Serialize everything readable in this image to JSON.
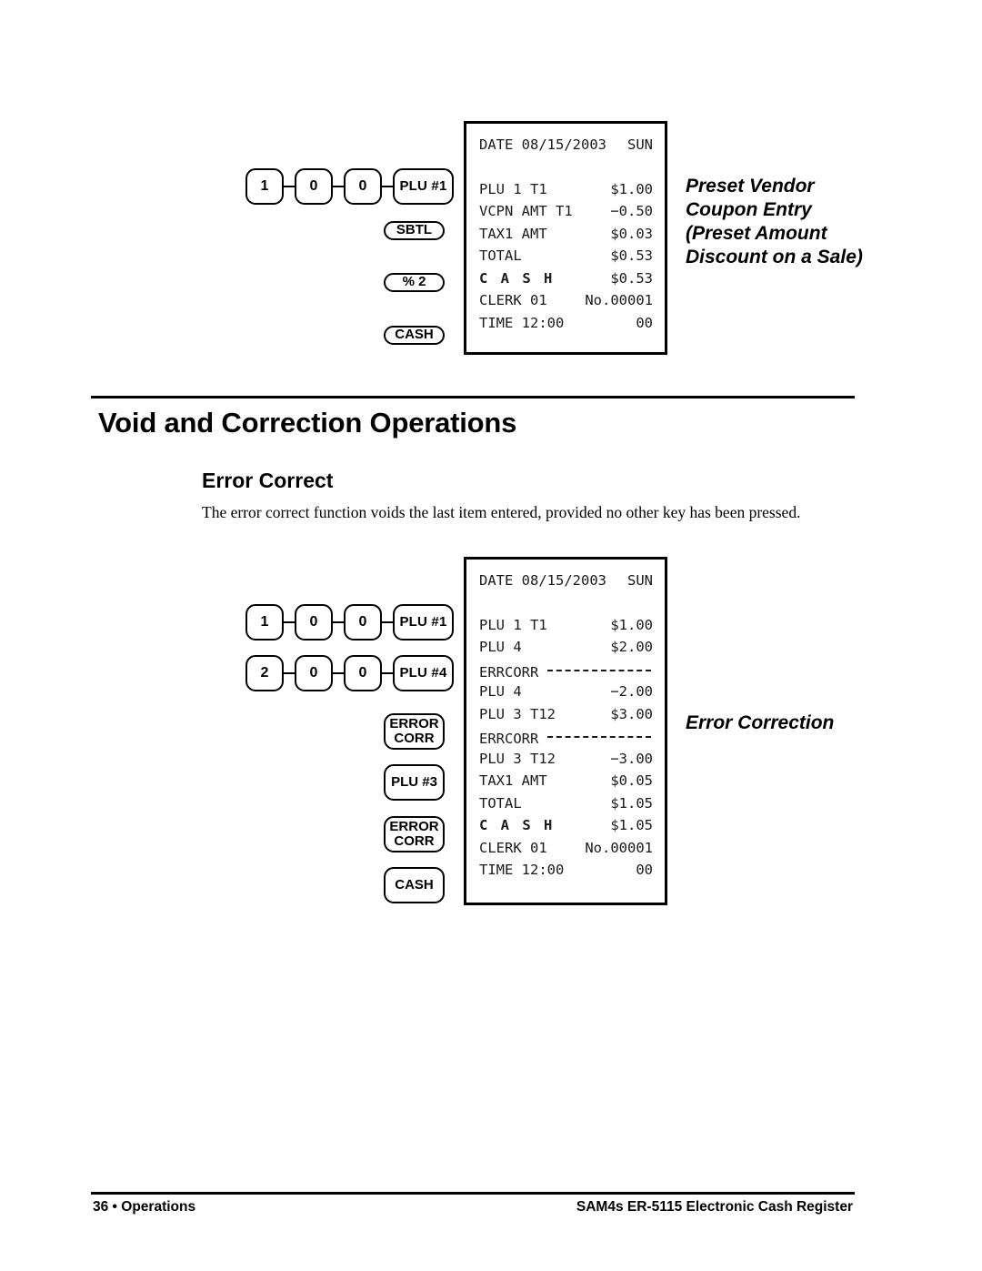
{
  "page": {
    "heading": "Void and Correction Operations",
    "subheading": "Error Correct",
    "body": "The error correct function voids the last item entered, provided no other key has been pressed."
  },
  "section_coupon": {
    "caption_line1": "Preset Vendor",
    "caption_line2": "Coupon Entry",
    "caption_line3": "(Preset Amount",
    "caption_line4": "Discount on a Sale)",
    "keys": {
      "row1": [
        "1",
        "0",
        "0",
        "PLU #1"
      ],
      "standalone": [
        {
          "label": "SBTL"
        },
        {
          "label": "% 2"
        },
        {
          "label": "CASH"
        }
      ]
    },
    "receipt": {
      "header": {
        "label": "DATE 08/15/2003",
        "amount": "SUN"
      },
      "lines": [
        {
          "label": "PLU 1 T1",
          "amount": "$1.00",
          "style": "normal"
        },
        {
          "label": "VCPN AMT T1",
          "amount": "−0.50",
          "style": "normal"
        },
        {
          "label": "TAX1 AMT",
          "amount": "$0.03",
          "style": "normal"
        },
        {
          "label": "TOTAL",
          "amount": "$0.53",
          "style": "normal"
        },
        {
          "label": "C A S H",
          "amount": "$0.53",
          "style": "bold"
        },
        {
          "label": "CLERK 01",
          "amount": "No.00001",
          "style": "normal"
        },
        {
          "label": "TIME 12:00",
          "amount": "00",
          "style": "normal"
        }
      ]
    }
  },
  "section_errorcorrect": {
    "caption": "Error Correction",
    "keys": {
      "row1": [
        "1",
        "0",
        "0",
        "PLU #1"
      ],
      "row2": [
        "2",
        "0",
        "0",
        "PLU #4"
      ],
      "standalone": [
        {
          "line1": "ERROR",
          "line2": "CORR"
        },
        {
          "line1": "PLU #3",
          "line2": ""
        },
        {
          "line1": "ERROR",
          "line2": "CORR"
        },
        {
          "line1": "CASH",
          "line2": ""
        }
      ]
    },
    "receipt": {
      "header": {
        "label": "DATE 08/15/2003",
        "amount": "SUN"
      },
      "lines": [
        {
          "label": "PLU 1 T1",
          "amount": "$1.00",
          "style": "normal"
        },
        {
          "label": "PLU 4",
          "amount": "$2.00",
          "style": "normal"
        },
        {
          "label": "ERRCORR",
          "amount": "",
          "style": "dash"
        },
        {
          "label": "PLU 4",
          "amount": "−2.00",
          "style": "normal"
        },
        {
          "label": "PLU 3 T12",
          "amount": "$3.00",
          "style": "normal"
        },
        {
          "label": "ERRCORR",
          "amount": "",
          "style": "dash"
        },
        {
          "label": "PLU 3 T12",
          "amount": "−3.00",
          "style": "normal"
        },
        {
          "label": "TAX1 AMT",
          "amount": "$0.05",
          "style": "normal"
        },
        {
          "label": "TOTAL",
          "amount": "$1.05",
          "style": "normal"
        },
        {
          "label": "C A S H",
          "amount": "$1.05",
          "style": "bold"
        },
        {
          "label": "CLERK 01",
          "amount": "No.00001",
          "style": "normal"
        },
        {
          "label": "TIME 12:00",
          "amount": "00",
          "style": "normal"
        }
      ]
    }
  },
  "footer": {
    "left": "36 • Operations",
    "right": "SAM4s ER-5115 Electronic Cash Register"
  }
}
